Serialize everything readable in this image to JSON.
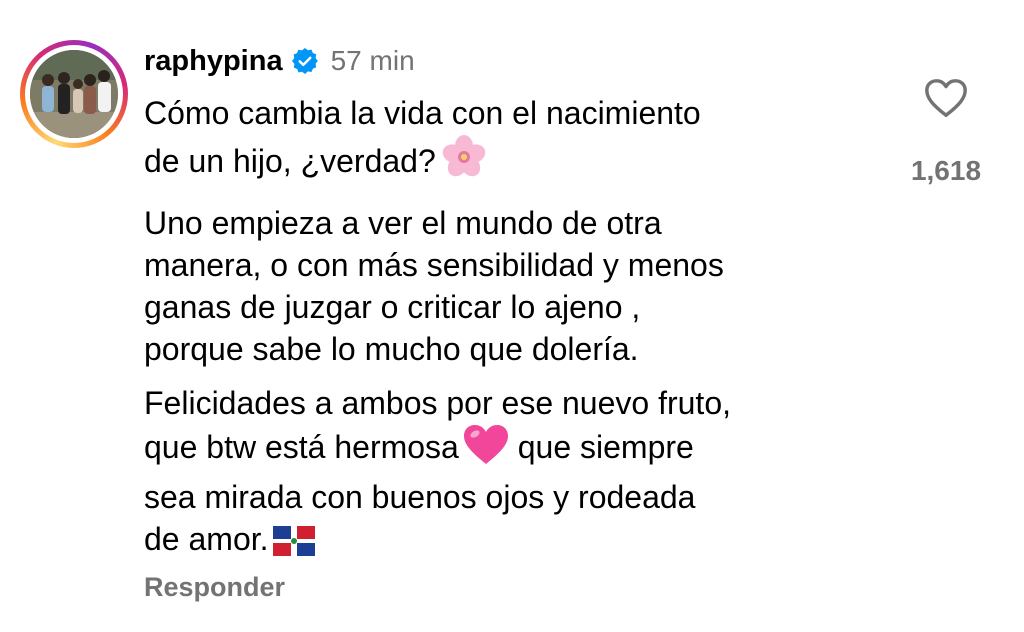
{
  "comment": {
    "username": "raphypina",
    "verified": true,
    "time": "57 min",
    "paragraphs": [
      "Cómo cambia la vida con el nacimiento\nde un hijo, ¿verdad?",
      "Uno empieza a ver el mundo de otra\nmanera, o con más sensibilidad y menos\nganas de juzgar o criticar lo ajeno ,\nporque sabe lo mucho que dolería.",
      "Felicidades a ambos por ese nuevo fruto,\nque btw está hermosa",
      " que siempre\nsea mirada con buenos ojos y rodeada\nde amor."
    ],
    "emojis": [
      "cherry-blossom",
      "pink-heart",
      "dominican-flag"
    ],
    "reply_label": "Responder",
    "like_count": "1,618"
  },
  "colors": {
    "text": "#000000",
    "secondary": "#737373",
    "verified_blue": "#0095f6"
  }
}
